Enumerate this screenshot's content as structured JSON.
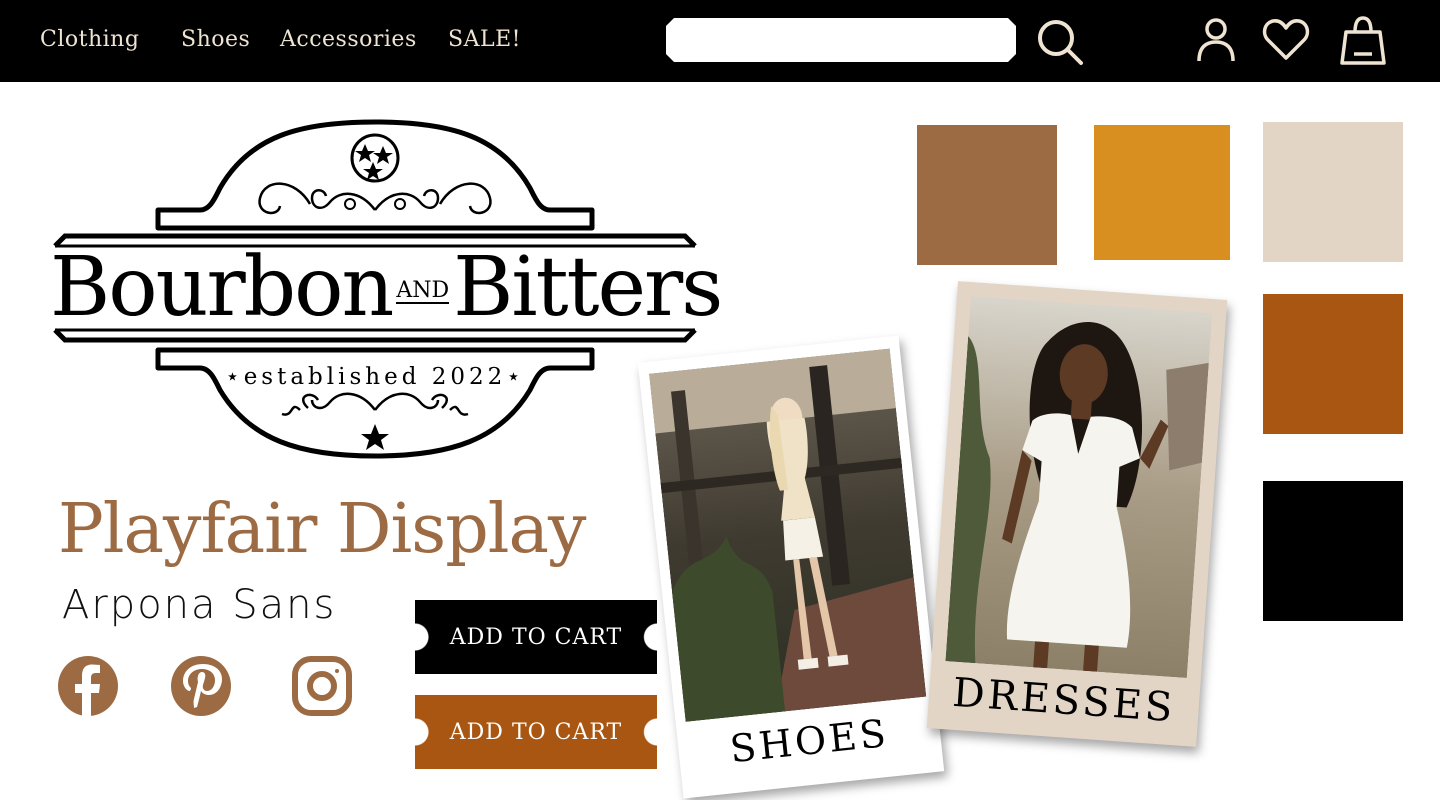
{
  "nav": {
    "items": [
      {
        "label": "Clothing"
      },
      {
        "label": "Shoes"
      },
      {
        "label": "Accessories"
      },
      {
        "label": "SALE!"
      }
    ]
  },
  "search": {
    "placeholder": ""
  },
  "header_icons": [
    "search-icon",
    "user-icon",
    "heart-icon",
    "shopping-bag-icon"
  ],
  "logo": {
    "word1": "Bourbon",
    "and": "AND",
    "word2": "Bitters",
    "established": "established 2022"
  },
  "fonts": {
    "heading": "Playfair Display",
    "sub": "Arpona Sans"
  },
  "social_icons": [
    "facebook-icon",
    "pinterest-icon",
    "instagram-icon"
  ],
  "buttons": {
    "add_to_cart_primary": "ADD TO CART",
    "add_to_cart_secondary": "ADD TO CART"
  },
  "cards": {
    "shoes": {
      "caption": "SHOES"
    },
    "dresses": {
      "caption": "DRESSES"
    }
  },
  "colors": {
    "accent_brown": "#9c6b43",
    "gold": "#d98e20",
    "cream": "#e3d5c5",
    "rust": "#a95613",
    "black": "#000000",
    "nav_text": "#efe3d2"
  }
}
